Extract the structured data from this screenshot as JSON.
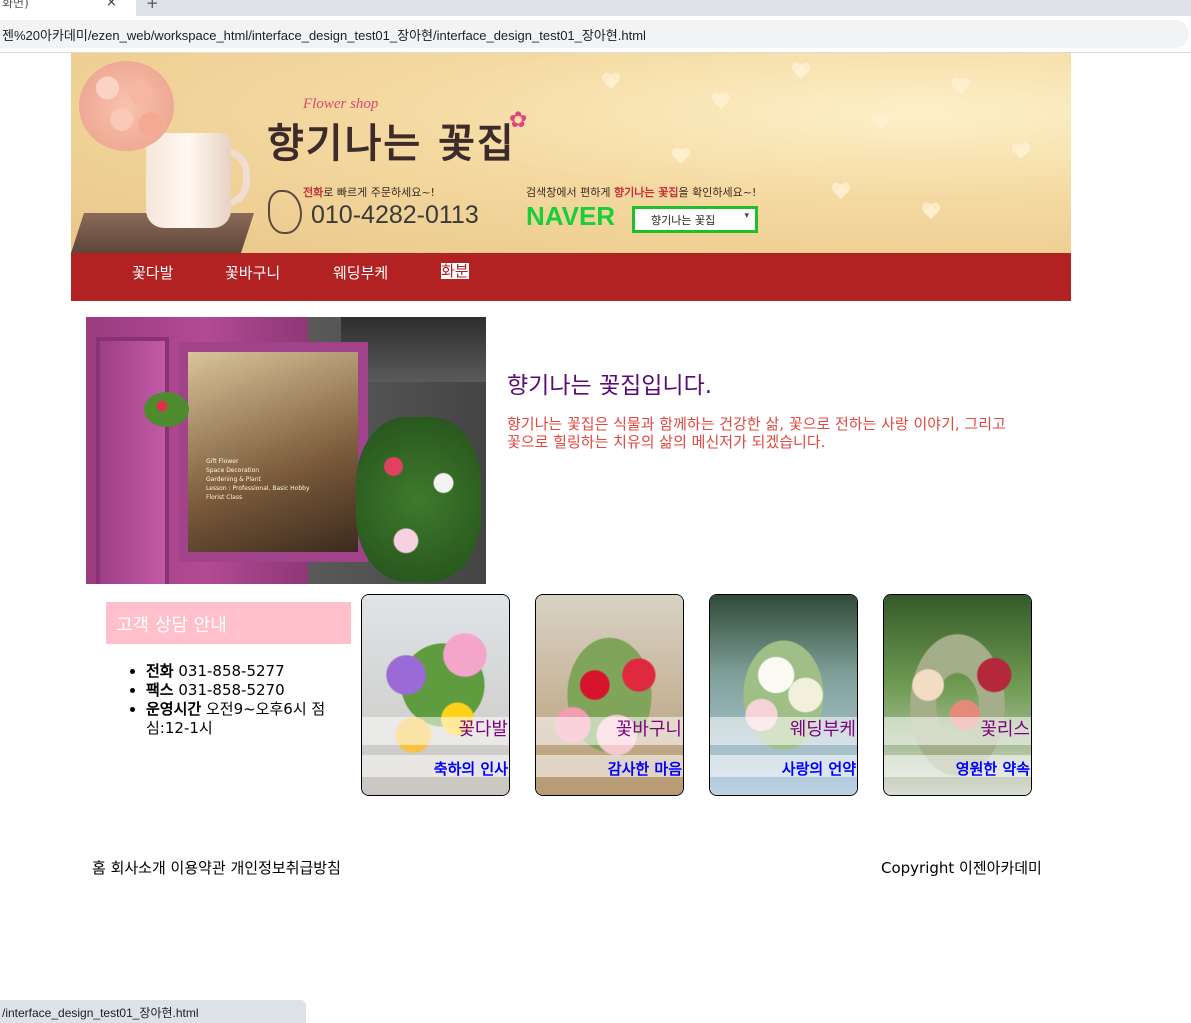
{
  "browser": {
    "tab_title": "화면)",
    "close_glyph": "×",
    "newtab_glyph": "+",
    "address": "젠%20아카데미/ezen_web/workspace_html/interface_design_test01_장아현/interface_design_test01_장아현.html",
    "status_url": "/interface_design_test01_장아현.html"
  },
  "banner": {
    "shop_en": "Flower shop",
    "shop_ko": "향기나는 꽃집",
    "phone_note_bold": "전화",
    "phone_note_rest": "로 빠르게 주문하세요~!",
    "phone_number": "010-4282-0113",
    "search_note_pre": "검색창에서 편하게 ",
    "search_note_bold": "향기나는 꽃집",
    "search_note_post": "을 확인하세요~!",
    "naver_logo": "NAVER",
    "naver_query": "향기나는 꽃집",
    "colors": {
      "nav_bg": "#b22222",
      "naver_green": "#19ce38"
    }
  },
  "nav": {
    "items": [
      {
        "label": "꽃다발"
      },
      {
        "label": "꽃바구니"
      },
      {
        "label": "웨딩부케"
      },
      {
        "label": "화분"
      }
    ]
  },
  "intro": {
    "storefront_sign": [
      "Gift Flower",
      "Space Decoration",
      "Gardening & Plant",
      "Lesson : Professional, Basic Hobby",
      "Florist Class"
    ],
    "title": "향기나는 꽃집입니다.",
    "text": "향기나는 꽃집은 식물과 함께하는 건강한 삶, 꽃으로 전하는 사랑 이야기, 그리고 꽃으로 힐링하는 치유의 삶의 메신저가 되겠습니다."
  },
  "consult": {
    "title": "고객 상담 안내",
    "items": [
      {
        "label": "전화",
        "value": " 031-858-5277"
      },
      {
        "label": "팩스",
        "value": " 031-858-5270"
      },
      {
        "label": "운영시간",
        "value": " 오전9~오후6시 점심:12-1시"
      }
    ]
  },
  "cards": [
    {
      "name": "꽃다발",
      "sub": "축하의 인사"
    },
    {
      "name": "꽃바구니",
      "sub": "감사한 마음"
    },
    {
      "name": "웨딩부케",
      "sub": "사랑의 언약"
    },
    {
      "name": "꽃리스",
      "sub": "영원한 약속"
    }
  ],
  "footer": {
    "links": "홈 회사소개 이용약관 개인정보취급방침",
    "copyright": "Copyright 이젠아카데미"
  }
}
